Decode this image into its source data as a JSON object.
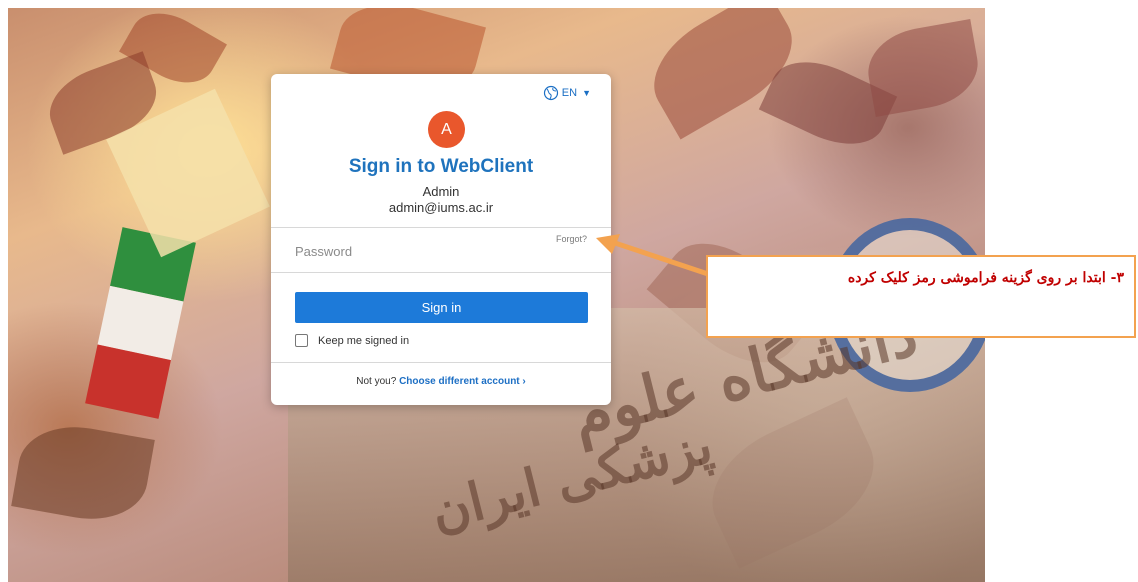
{
  "language": {
    "label": "EN"
  },
  "login": {
    "avatar_initial": "A",
    "title": "Sign in to WebClient",
    "user_name": "Admin",
    "user_email": "admin@iums.ac.ir",
    "password_placeholder": "Password",
    "forgot_label": "Forgot?",
    "signin_label": "Sign in",
    "keep_signed_in_label": "Keep me signed in",
    "not_you_label": "Not you?",
    "choose_account_label": "Choose different account ›"
  },
  "annotation": {
    "text": "۳- ابتدا بر روی گزینه فراموشی رمز کلیک کرده",
    "border_color": "#f3a24f",
    "text_color": "#c00000"
  },
  "colors": {
    "accent": "#1d7ad9",
    "avatar": "#e9572c",
    "title": "#1f73bd"
  },
  "icons": {
    "language": "globe-icon",
    "dropdown": "chevron-down-icon"
  }
}
